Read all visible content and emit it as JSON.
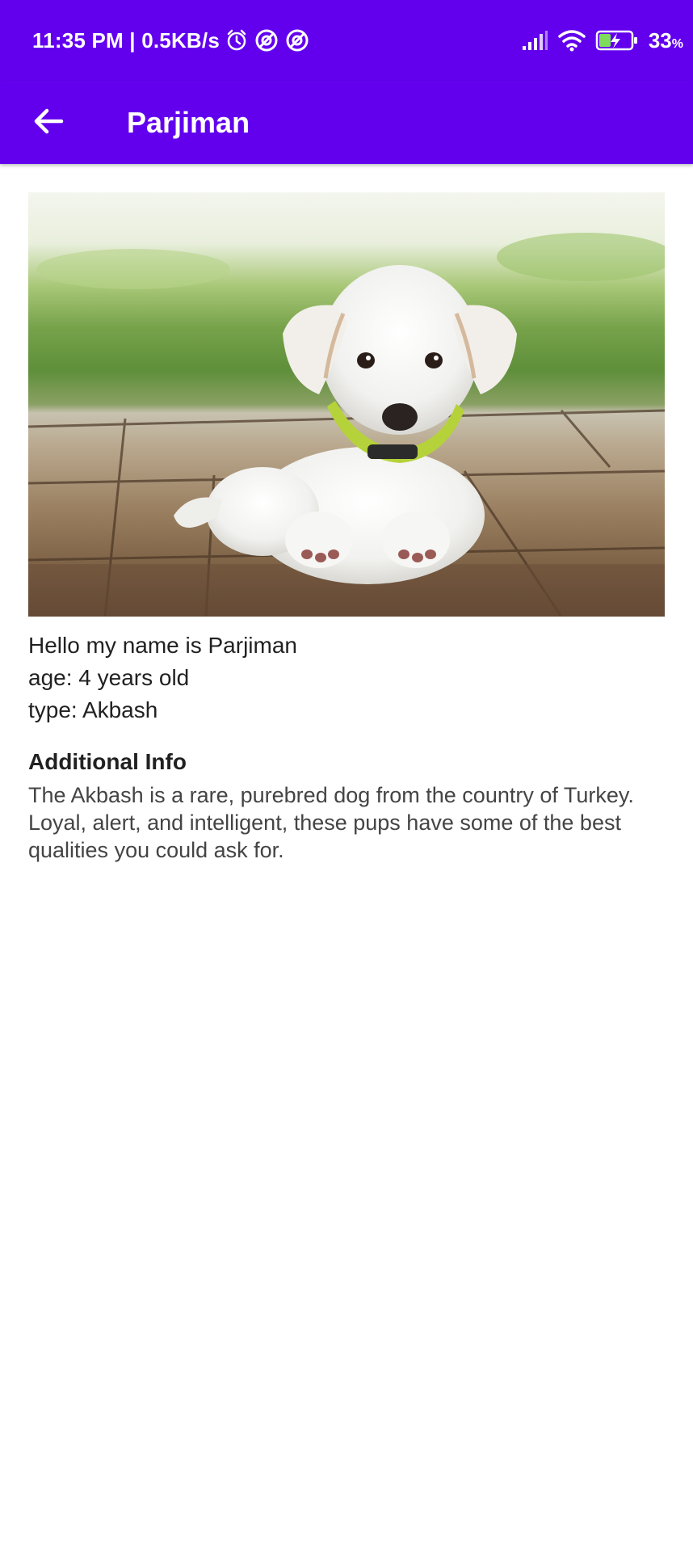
{
  "status_bar": {
    "time_and_speed": "11:35 PM | 0.5KB/s",
    "battery_percent": "33",
    "battery_percent_sign": "%",
    "icons": [
      "alarm-icon",
      "location-off-icon",
      "location-off-icon",
      "signal-icon",
      "wifi-icon",
      "battery-charging-icon"
    ]
  },
  "app_bar": {
    "title": "Parjiman",
    "back_icon": "arrow-left-icon",
    "background_color": "#6200ee"
  },
  "pet": {
    "photo_alt": "White puppy lying on wooden deck",
    "greeting": "Hello my name is Parjiman",
    "age_line": "age: 4 years old",
    "type_line": "type: Akbash"
  },
  "additional_info": {
    "heading": "Additional Info",
    "body": "The Akbash is a rare, purebred dog from the country of Turkey. Loyal, alert, and intelligent, these pups have some of the best qualities you could ask for."
  }
}
